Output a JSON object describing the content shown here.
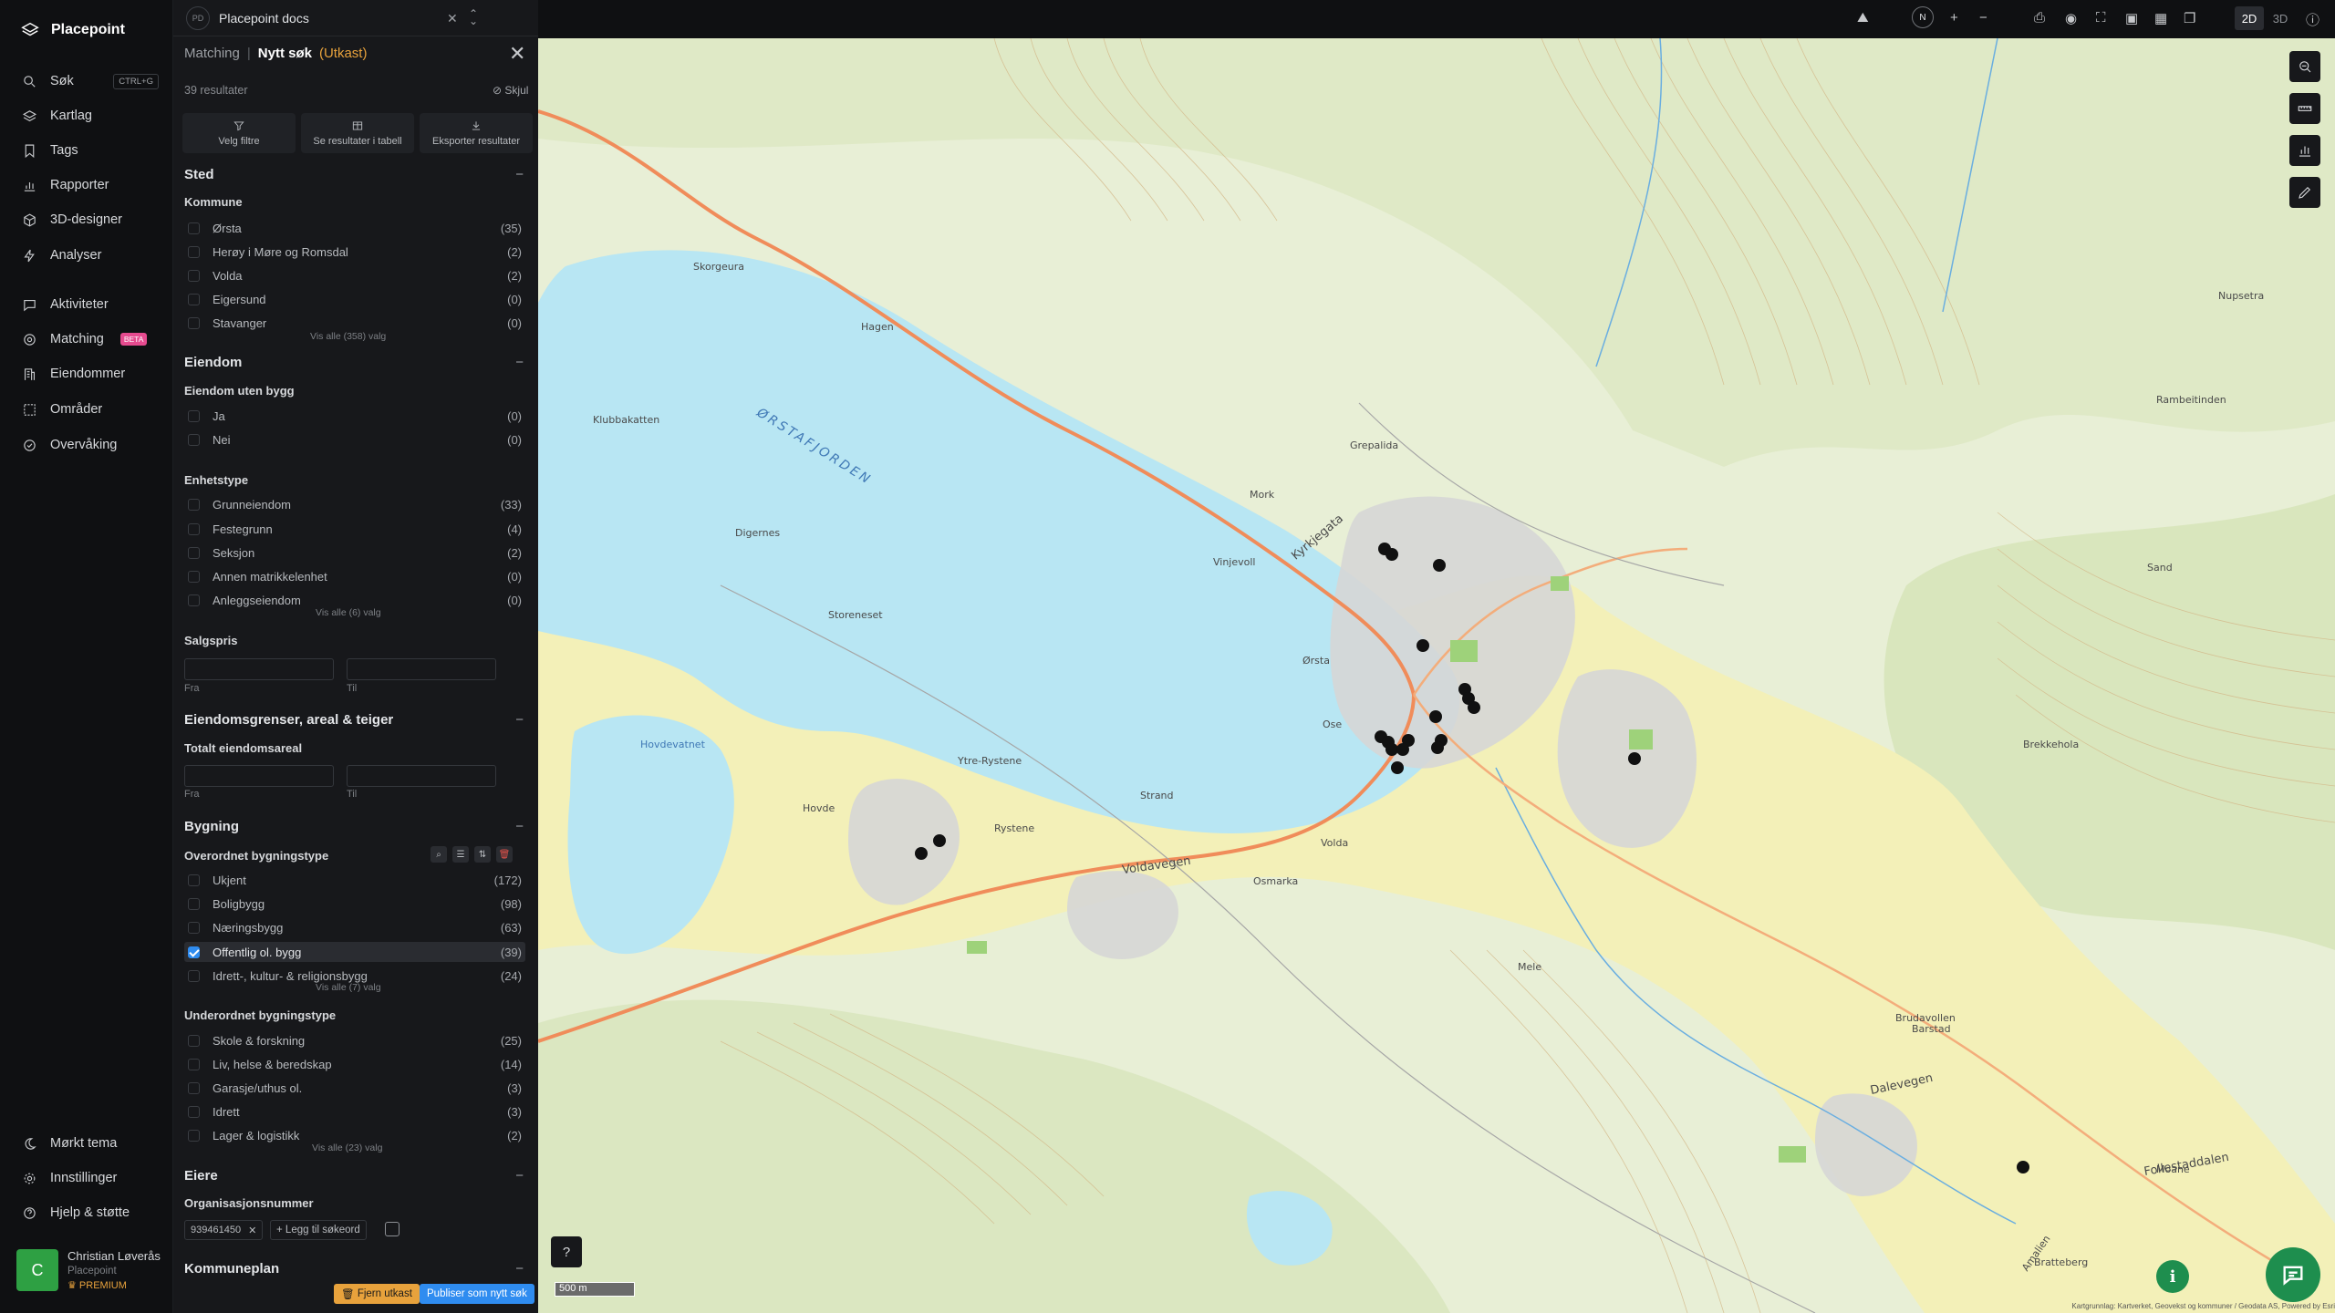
{
  "app": {
    "name": "Placepoint"
  },
  "nav": {
    "items": [
      {
        "label": "Søk",
        "shortcut": "CTRL+G",
        "icon": "search-icon"
      },
      {
        "label": "Kartlag",
        "icon": "layers-icon"
      },
      {
        "label": "Tags",
        "icon": "bookmark-icon"
      },
      {
        "label": "Rapporter",
        "icon": "chart-icon"
      },
      {
        "label": "3D-designer",
        "icon": "cube-icon"
      },
      {
        "label": "Analyser",
        "icon": "bolt-icon"
      },
      {
        "label": "Aktiviteter",
        "icon": "chat-icon"
      },
      {
        "label": "Matching",
        "badge": "BETA",
        "icon": "target-icon"
      },
      {
        "label": "Eiendommer",
        "icon": "building-icon"
      },
      {
        "label": "Områder",
        "icon": "area-icon"
      },
      {
        "label": "Overvåking",
        "icon": "check-circle-icon"
      }
    ],
    "footer": [
      {
        "label": "Mørkt tema",
        "icon": "moon-icon"
      },
      {
        "label": "Innstillinger",
        "icon": "gear-icon"
      },
      {
        "label": "Hjelp & støtte",
        "icon": "help-icon"
      }
    ],
    "user": {
      "initial": "C",
      "name": "Christian Løverås",
      "org": "Placepoint",
      "tier": "PREMIUM"
    }
  },
  "tab": {
    "badge": "PD",
    "title": "Placepoint docs"
  },
  "panel": {
    "crumb": "Matching",
    "separator": "|",
    "title": "Nytt søk",
    "status": "(Utkast)",
    "results": "39 resultater",
    "hide": "Skjul",
    "actions": [
      "Velg filtre",
      "Se resultater i tabell",
      "Eksporter resultater"
    ],
    "sections": {
      "sted": {
        "title": "Sted",
        "kommune": {
          "title": "Kommune",
          "rows": [
            {
              "label": "Ørsta",
              "count": "(35)"
            },
            {
              "label": "Herøy i Møre og Romsdal",
              "count": "(2)"
            },
            {
              "label": "Volda",
              "count": "(2)"
            },
            {
              "label": "Eigersund",
              "count": "(0)"
            },
            {
              "label": "Stavanger",
              "count": "(0)"
            }
          ],
          "more": "Vis alle (358) valg"
        }
      },
      "eiendom": {
        "title": "Eiendom",
        "uten_bygg": {
          "title": "Eiendom uten bygg",
          "rows": [
            {
              "label": "Ja",
              "count": "(0)"
            },
            {
              "label": "Nei",
              "count": "(0)"
            }
          ]
        },
        "enhetstype": {
          "title": "Enhetstype",
          "rows": [
            {
              "label": "Grunneiendom",
              "count": "(33)"
            },
            {
              "label": "Festegrunn",
              "count": "(4)"
            },
            {
              "label": "Seksjon",
              "count": "(2)"
            },
            {
              "label": "Annen matrikkelenhet",
              "count": "(0)"
            },
            {
              "label": "Anleggseiendom",
              "count": "(0)"
            }
          ],
          "more": "Vis alle (6) valg"
        },
        "salgspris": {
          "title": "Salgspris",
          "from": "Fra",
          "to": "Til"
        }
      },
      "grenser": {
        "title": "Eiendomsgrenser, areal & teiger",
        "areal": {
          "title": "Totalt eiendomsareal",
          "from": "Fra",
          "to": "Til"
        }
      },
      "bygning": {
        "title": "Bygning",
        "overordnet": {
          "title": "Overordnet bygningstype",
          "rows": [
            {
              "label": "Ukjent",
              "count": "(172)"
            },
            {
              "label": "Boligbygg",
              "count": "(98)"
            },
            {
              "label": "Næringsbygg",
              "count": "(63)"
            },
            {
              "label": "Offentlig ol. bygg",
              "count": "(39)",
              "checked": true
            },
            {
              "label": "Idrett-, kultur- & religionsbygg",
              "count": "(24)"
            }
          ],
          "more": "Vis alle (7) valg"
        },
        "underordnet": {
          "title": "Underordnet bygningstype",
          "rows": [
            {
              "label": "Skole & forskning",
              "count": "(25)"
            },
            {
              "label": "Liv, helse & beredskap",
              "count": "(14)"
            },
            {
              "label": "Garasje/uthus ol.",
              "count": "(3)"
            },
            {
              "label": "Idrett",
              "count": "(3)"
            },
            {
              "label": "Lager & logistikk",
              "count": "(2)"
            }
          ],
          "more": "Vis alle (23) valg"
        }
      },
      "eiere": {
        "title": "Eiere",
        "org": {
          "title": "Organisasjonsnummer",
          "tag": "939461450",
          "add": "Legg til søkeord"
        }
      },
      "kommuneplan": {
        "title": "Kommuneplan"
      }
    },
    "footer": {
      "remove": "Fjern utkast",
      "publish": "Publiser som nytt søk"
    }
  },
  "toolbar": {
    "north": "N",
    "mode_2d": "2D",
    "mode_3d": "3D"
  },
  "map": {
    "scale": "500 m",
    "attribution": "Kartgrunnlag: Kartverket, Geovekst og kommuner / Geodata AS, Powered by Esri",
    "labels": [
      "ØRSTAFJORDEN",
      "Ørsta",
      "Volda",
      "Voldavegen",
      "Dalevegen",
      "Follestaddalen",
      "Rystene",
      "Ytre-Rystene",
      "Strand",
      "Storeneset",
      "Digernes",
      "Hovde",
      "Hovdevatnet",
      "Kyrkjegata",
      "Ose",
      "Mork",
      "Vinjevoll",
      "Grepalida",
      "Skorgeura",
      "Hagen",
      "Klubbakatten",
      "Rambeitinden",
      "Nupsetra",
      "Sand",
      "Brekkehola",
      "Barstad",
      "Mele",
      "Osmarka",
      "Moane",
      "Amalien",
      "Brudavollen",
      "Bratteberg"
    ]
  }
}
